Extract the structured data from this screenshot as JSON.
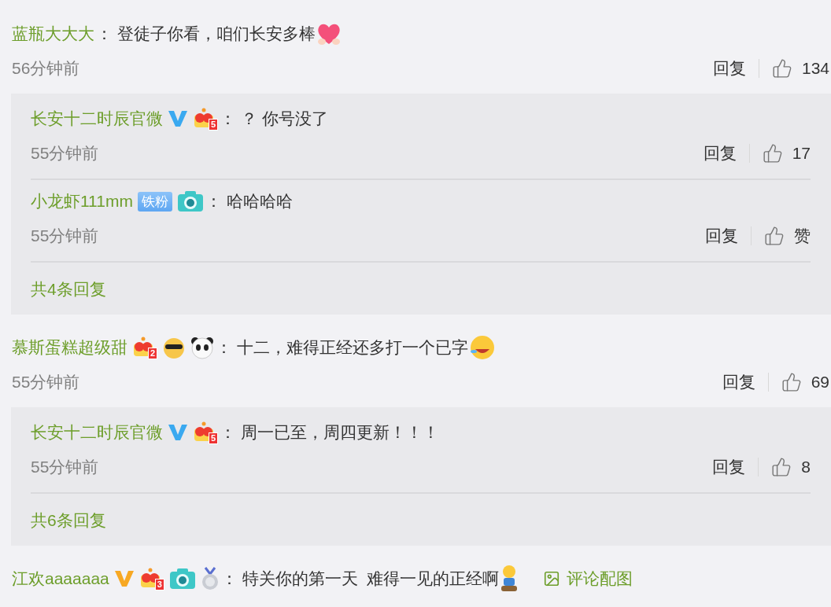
{
  "comments": [
    {
      "name": "蓝瓶大大大",
      "sep": "：",
      "text": "登徒子你看，咱们长安多棒",
      "emoji": {
        "kind": "heart"
      },
      "time": "56分钟前",
      "reply_action": "回复",
      "likes": "134",
      "replies": [
        {
          "name": "长安十二时辰官微",
          "badges": [
            {
              "kind": "v",
              "color": "#3aa9f0"
            },
            {
              "kind": "crown",
              "label": "5"
            }
          ],
          "sep": "：",
          "text": "？ 你号没了",
          "time": "55分钟前",
          "reply_action": "回复",
          "likes": "17"
        },
        {
          "name": "小龙虾111mm",
          "badges": [
            {
              "kind": "tag",
              "label": "铁粉"
            },
            {
              "kind": "camera"
            }
          ],
          "sep": "：",
          "text": "哈哈哈哈",
          "time": "55分钟前",
          "reply_action": "回复",
          "likes": "赞"
        }
      ],
      "more": "共4条回复"
    },
    {
      "name": "慕斯蛋糕超级甜",
      "badges": [
        {
          "kind": "crown",
          "label": "2"
        },
        {
          "kind": "cool-cat"
        },
        {
          "kind": "panda"
        }
      ],
      "sep": "：",
      "text": "十二，难得正经还多打一个已字",
      "emoji": {
        "kind": "laugh"
      },
      "time": "55分钟前",
      "reply_action": "回复",
      "likes": "69",
      "replies": [
        {
          "name": "长安十二时辰官微",
          "badges": [
            {
              "kind": "v",
              "color": "#3aa9f0"
            },
            {
              "kind": "crown",
              "label": "5"
            }
          ],
          "sep": "：",
          "text": "周一已至，周四更新！！！",
          "time": "55分钟前",
          "reply_action": "回复",
          "likes": "8"
        }
      ],
      "more": "共6条回复"
    },
    {
      "name": "江欢aaaaaaa",
      "badges": [
        {
          "kind": "v",
          "color": "#f7a823"
        },
        {
          "kind": "crown",
          "label": "3"
        },
        {
          "kind": "camera"
        },
        {
          "kind": "medal"
        }
      ],
      "sep": "：",
      "text": "特关你的第一天  难得一见的正经啊",
      "emoji": {
        "kind": "kneel"
      },
      "attachment": "评论配图"
    }
  ]
}
